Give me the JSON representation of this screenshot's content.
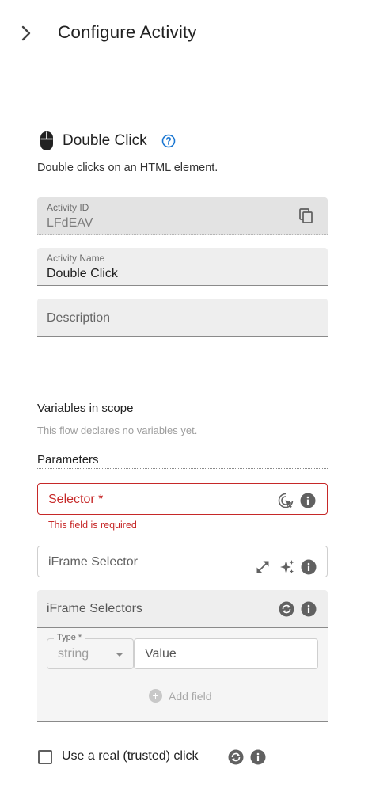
{
  "header": {
    "title": "Configure Activity",
    "collapse_icon": "chevron-right-icon"
  },
  "activity": {
    "icon": "mouse-icon",
    "title": "Double Click",
    "description": "Double clicks on an HTML element."
  },
  "fields": {
    "activity_id": {
      "label": "Activity ID",
      "value": "LFdEAV"
    },
    "activity_name": {
      "label": "Activity Name",
      "value": "Double Click"
    },
    "description": {
      "placeholder": "Description"
    }
  },
  "variables": {
    "title": "Variables in scope",
    "note": "This flow declares no variables yet."
  },
  "parameters": {
    "title": "Parameters",
    "selector": {
      "label": "Selector *",
      "error": "This field is required"
    },
    "iframe_selector": {
      "label": "iFrame Selector"
    },
    "iframe_selectors": {
      "label": "iFrame Selectors",
      "type_label": "Type *",
      "type_value": "string",
      "value_placeholder": "Value",
      "add_field": "Add field"
    },
    "trusted_click": {
      "label": "Use a real (trusted) click",
      "checked": false
    }
  },
  "colors": {
    "error": "#c62828",
    "accent": "#1976d2",
    "icon": "#616161"
  }
}
